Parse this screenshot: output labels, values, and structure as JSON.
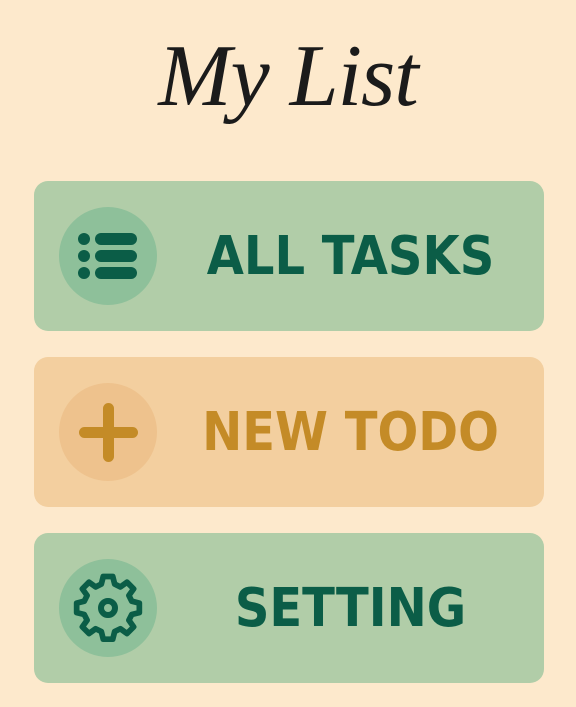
{
  "title": "My List",
  "colors": {
    "background": "#fde9cc",
    "green_card": "#b1cda8",
    "green_circle": "#8ec09a",
    "green_text": "#0b5d47",
    "orange_card": "#f3cf9f",
    "orange_circle": "#eec28d",
    "orange_text": "#c48b27"
  },
  "menu": [
    {
      "label": "ALL TASKS",
      "icon": "list-icon"
    },
    {
      "label": "NEW TODO",
      "icon": "plus-icon"
    },
    {
      "label": "SETTING",
      "icon": "gear-icon"
    }
  ]
}
